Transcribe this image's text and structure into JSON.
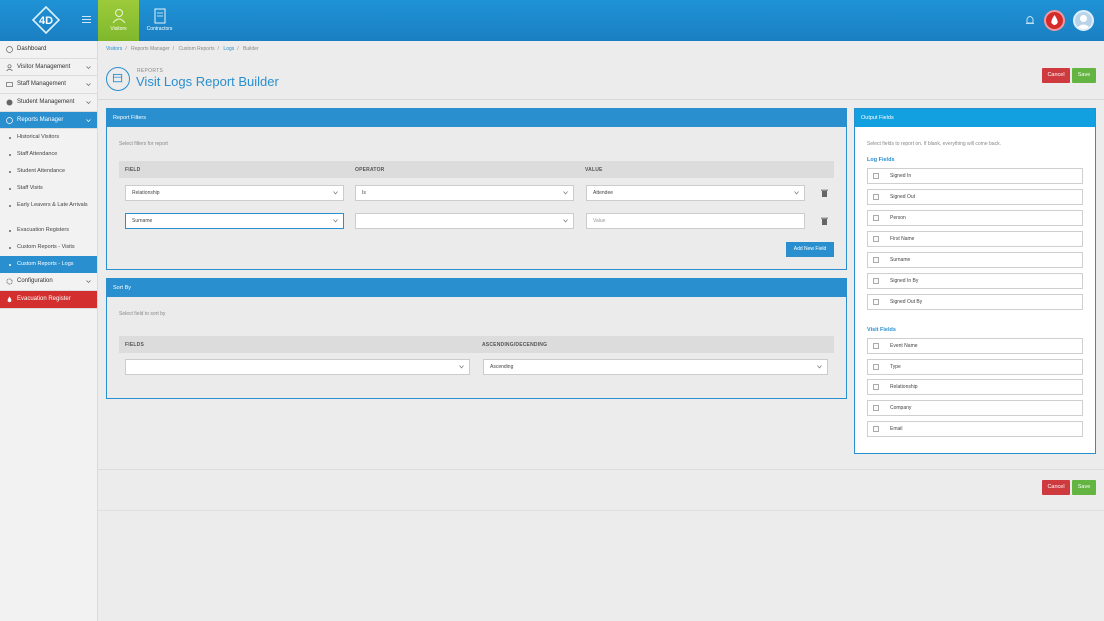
{
  "app": {
    "brand": "4D",
    "accent": "#2a8fcf",
    "success": "#64b442",
    "danger": "#cf3a3f"
  },
  "topnav": {
    "tabs": [
      {
        "label": "Visitors",
        "icon": "person-icon",
        "active": true
      },
      {
        "label": "Contractors",
        "icon": "document-icon",
        "active": false
      }
    ]
  },
  "sidebar": {
    "items": [
      {
        "label": "Dashboard",
        "icon": "dashboard-icon"
      },
      {
        "label": "Visitor Management",
        "icon": "person-icon"
      },
      {
        "label": "Staff Management",
        "icon": "id-card-icon"
      },
      {
        "label": "Student Management",
        "icon": "student-icon"
      },
      {
        "label": "Reports Manager",
        "icon": "reports-icon"
      }
    ],
    "sub_items": [
      "Historical Visitors",
      "Staff Attendance",
      "Student Attendance",
      "Staff Visits",
      "Early Leavers & Late Arrivals",
      "Evacuation Registers",
      "Custom Reports - Visits",
      "Custom Reports - Logs"
    ],
    "configuration": "Configuration",
    "evacuation": "Evacuation Register"
  },
  "breadcrumb": [
    "Visitors",
    "Reports Manager",
    "Custom Reports",
    "Logs",
    "Builder"
  ],
  "page": {
    "kicker": "REPORTS",
    "title": "Visit Logs Report Builder"
  },
  "actions": {
    "cancel": "Cancel",
    "save": "Save"
  },
  "filters": {
    "title": "Report Filters",
    "hint": "Select filters for report",
    "columns": [
      "FIELD",
      "OPERATOR",
      "VALUE"
    ],
    "rows": [
      {
        "field": "Relationship",
        "operator": "Is",
        "value": "Attendee"
      },
      {
        "field": "Surname",
        "operator": "",
        "value_placeholder": "Value"
      }
    ],
    "add_label": "Add New Field"
  },
  "sort": {
    "title": "Sort By",
    "hint": "Select field to sort by",
    "columns": [
      "FIELDS",
      "ASCENDING/DECENDING"
    ],
    "field": "",
    "direction": "Ascending"
  },
  "output": {
    "title": "Output Fields",
    "hint": "Select fields to report on. If blank, everything will come back.",
    "log_title": "Log Fields",
    "log_fields": [
      "Signed In",
      "Signed Out",
      "Person",
      "First Name",
      "Surname",
      "Signed In By",
      "Signed Out By"
    ],
    "visit_title": "Visit Fields",
    "visit_fields": [
      "Event Name",
      "Type",
      "Relationship",
      "Company",
      "Email"
    ]
  }
}
